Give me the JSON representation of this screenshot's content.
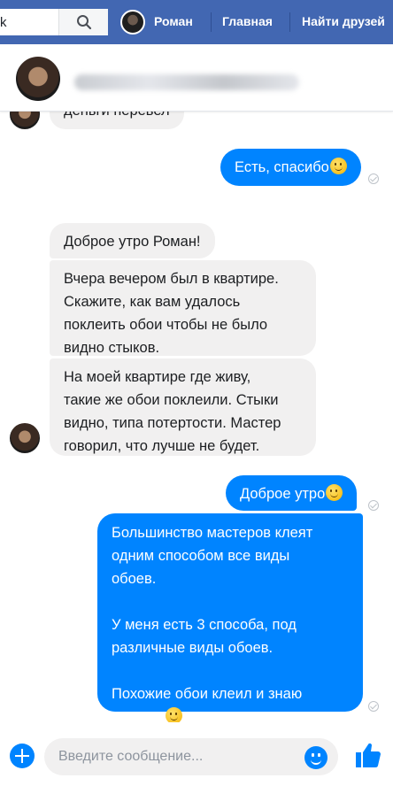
{
  "topbar": {
    "search_value": "k",
    "profile_name": "Роман",
    "nav_home": "Главная",
    "nav_find_friends": "Найти друзей",
    "brand_color": "#4267b2"
  },
  "chat_header": {
    "contact_name": ""
  },
  "messages": [
    {
      "direction": "incoming",
      "text": "деньги перевел"
    },
    {
      "direction": "outgoing",
      "text": "Есть, спасибо",
      "emoji": "smile"
    },
    {
      "direction": "incoming",
      "text": "Доброе утро Роман!"
    },
    {
      "direction": "incoming",
      "text": "Вчера вечером был в квартире.\nСкажите, как вам удалось\nпоклеить обои чтобы не было\nвидно стыков."
    },
    {
      "direction": "incoming",
      "text": "На моей квартире где живу,\nтакие же обои поклеили. Стыки\nвидно, типа потертости. Мастер\nговорил, что лучше не будет."
    },
    {
      "direction": "outgoing",
      "text": "Доброе утро",
      "emoji": "smile"
    },
    {
      "direction": "outgoing",
      "text": "Большинство мастеров клеят\nодним способом все виды\nобоев.\n\nУ меня есть 3 способа, под\nразличные виды обоев.\n\nПохожие обои клеил и знаю\nнюансы",
      "emoji": "smirk"
    }
  ],
  "composer": {
    "placeholder": "Введите сообщение...",
    "accent_color": "#0084ff"
  },
  "icons": [
    "search-icon",
    "add-icon",
    "emoji-icon",
    "like-icon",
    "seen-check-icon"
  ]
}
